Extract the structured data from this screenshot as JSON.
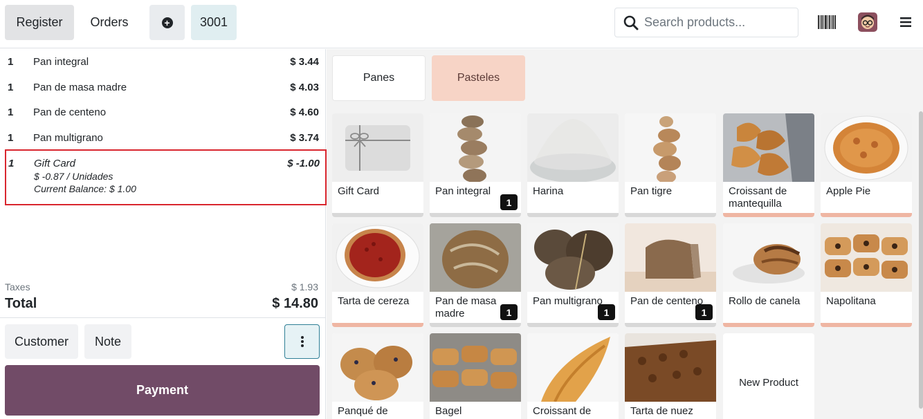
{
  "header": {
    "register_label": "Register",
    "orders_label": "Orders",
    "order_number": "3001",
    "search_placeholder": "Search products...",
    "icons": {
      "plus": "plus-circle-icon",
      "search": "search-icon",
      "barcode": "barcode-icon",
      "avatar": "user-avatar",
      "menu": "hamburger-menu-icon"
    }
  },
  "order": {
    "lines": [
      {
        "qty": "1",
        "name": "Pan integral",
        "price": "$ 3.44"
      },
      {
        "qty": "1",
        "name": "Pan de masa madre",
        "price": "$ 4.03"
      },
      {
        "qty": "1",
        "name": "Pan de centeno",
        "price": "$ 4.60"
      },
      {
        "qty": "1",
        "name": "Pan multigrano",
        "price": "$ 3.74"
      }
    ],
    "gift_line": {
      "qty": "1",
      "name": "Gift Card",
      "price": "$ -1.00",
      "unit_info": "$ -0.87 / Unidades",
      "balance": "Current Balance: $ 1.00"
    },
    "taxes_label": "Taxes",
    "taxes_value": "$ 1.93",
    "total_label": "Total",
    "total_value": "$ 14.80"
  },
  "actions": {
    "customer_label": "Customer",
    "note_label": "Note",
    "payment_label": "Payment"
  },
  "categories": [
    "Panes",
    "Pasteles"
  ],
  "products": [
    {
      "name": "Gift Card",
      "badge": "",
      "bar": "grey"
    },
    {
      "name": "Pan integral",
      "badge": "1",
      "bar": "grey"
    },
    {
      "name": "Harina",
      "badge": "",
      "bar": "grey"
    },
    {
      "name": "Pan tigre",
      "badge": "",
      "bar": "grey"
    },
    {
      "name": "Croissant de mantequilla",
      "badge": "",
      "bar": "pink"
    },
    {
      "name": "Apple Pie",
      "badge": "",
      "bar": "pink"
    },
    {
      "name": "Tarta de cereza",
      "badge": "",
      "bar": "pink"
    },
    {
      "name": "Pan de masa madre",
      "badge": "1",
      "bar": "grey"
    },
    {
      "name": "Pan multigrano",
      "badge": "1",
      "bar": "grey"
    },
    {
      "name": "Pan de centeno",
      "badge": "1",
      "bar": "grey"
    },
    {
      "name": "Rollo de canela",
      "badge": "",
      "bar": "pink"
    },
    {
      "name": "Napolitana",
      "badge": "",
      "bar": "pink"
    },
    {
      "name": "Panqué de",
      "badge": "",
      "bar": "grey"
    },
    {
      "name": "Bagel",
      "badge": "",
      "bar": "grey"
    },
    {
      "name": "Croissant de",
      "badge": "",
      "bar": "grey"
    },
    {
      "name": "Tarta de nuez",
      "badge": "",
      "bar": "grey"
    },
    {
      "name": "New Product",
      "badge": "",
      "bar": "none"
    }
  ],
  "colors": {
    "payment": "#714b67",
    "pasteles_category": "#f7d4c6",
    "highlight_border": "#d9262e",
    "pink_bar": "#efb6a3"
  }
}
